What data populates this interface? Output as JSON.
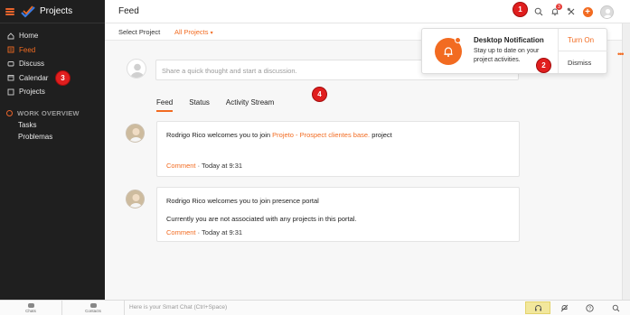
{
  "app": {
    "name": "Projects"
  },
  "sidebar": {
    "items": [
      {
        "label": "Home",
        "icon": "home-icon"
      },
      {
        "label": "Feed",
        "icon": "feed-icon",
        "active": true
      },
      {
        "label": "Discuss",
        "icon": "discuss-icon"
      },
      {
        "label": "Calendar",
        "icon": "calendar-icon"
      },
      {
        "label": "Projects",
        "icon": "projects-icon"
      }
    ],
    "section": {
      "label": "WORK OVERVIEW",
      "icon": "work-overview-icon"
    },
    "sub_items": [
      {
        "label": "Tasks"
      },
      {
        "label": "Problemas"
      }
    ]
  },
  "header": {
    "title": "Feed",
    "notification_count": "3",
    "icons": [
      "search-icon",
      "bell-icon",
      "tools-icon",
      "add-icon",
      "user-avatar"
    ]
  },
  "subheader": {
    "select_label": "Select Project",
    "select_value": "All Projects"
  },
  "composer": {
    "placeholder": "Share a quick thought and start a discussion."
  },
  "tabs": [
    {
      "label": "Feed",
      "active": true
    },
    {
      "label": "Status"
    },
    {
      "label": "Activity Stream"
    }
  ],
  "posts": [
    {
      "author": "Rodrigo Rico",
      "text_before": " welcomes you to join ",
      "link": "Projeto - Prospect clientes base.",
      "text_after": " project",
      "line2": "",
      "comment_label": "Comment",
      "time": " · Today at 9:31"
    },
    {
      "author": "Rodrigo Rico",
      "text_before": " welcomes you to join presence portal",
      "link": "",
      "text_after": "",
      "line2": "Currently you are not associated with any projects in this portal.",
      "comment_label": "Comment",
      "time": " · Today at 9:31"
    }
  ],
  "notification": {
    "title": "Desktop Notification",
    "body": "Stay up to date on your project activities.",
    "turn_on": "Turn On",
    "dismiss": "Dismiss"
  },
  "markers": [
    "1",
    "2",
    "3",
    "4"
  ],
  "bottombar": {
    "tabs": [
      "Chats",
      "Contacts"
    ],
    "smart_chat_placeholder": "Here is your Smart Chat (Ctrl+Space)"
  },
  "colors": {
    "accent": "#f26b21",
    "sidebar_bg": "#1f1f1f",
    "marker": "#e01e1e"
  }
}
